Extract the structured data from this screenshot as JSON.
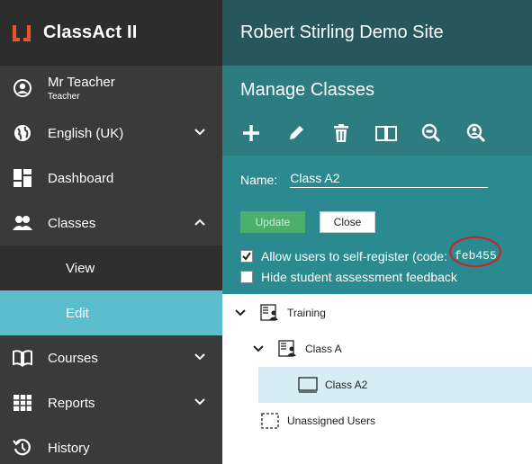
{
  "app": {
    "name": "ClassAct II",
    "site_title": "Robert Stirling Demo Site",
    "colors": {
      "accent": "#e8542b",
      "sidebar": "#3a3a3a",
      "header": "#27575d",
      "panel": "#2c7c80",
      "active": "#5bbccc",
      "ring": "#d11e1e"
    }
  },
  "user": {
    "name": "Mr Teacher",
    "role": "Teacher"
  },
  "sidebar": {
    "items": [
      {
        "label": "English (UK)",
        "icon": "globe-icon"
      },
      {
        "label": "Dashboard",
        "icon": "dashboard-icon"
      },
      {
        "label": "Classes",
        "icon": "users-icon"
      },
      {
        "label": "Courses",
        "icon": "book-icon"
      },
      {
        "label": "Reports",
        "icon": "table-icon"
      },
      {
        "label": "History",
        "icon": "history-icon"
      }
    ],
    "sub_items": [
      {
        "label": "View"
      },
      {
        "label": "Edit",
        "active": true
      }
    ]
  },
  "panel": {
    "title": "Manage Classes",
    "toolbar": [
      "add-icon",
      "edit-icon",
      "delete-icon",
      "book-icon",
      "zoom-icon",
      "search-user-icon"
    ],
    "form": {
      "name_label": "Name:",
      "name_value": "Class A2",
      "update_label": "Update",
      "close_label": "Close",
      "self_register_label": "Allow users to self-register (code:",
      "self_register_code": "feb455",
      "self_register_checked": true,
      "hide_feedback_label": "Hide student assessment feedback",
      "hide_feedback_checked": false
    }
  },
  "tree": {
    "nodes": [
      {
        "label": "Training",
        "expanded": true
      },
      {
        "label": "Class A",
        "expanded": true
      },
      {
        "label": "Class A2",
        "selected": true
      },
      {
        "label": "Unassigned Users"
      }
    ]
  }
}
